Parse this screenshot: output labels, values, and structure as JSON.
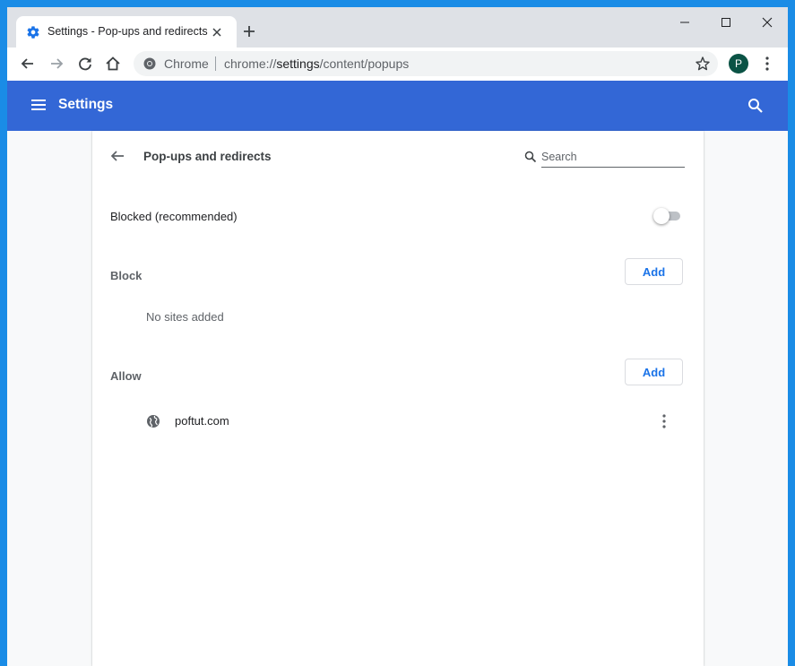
{
  "window": {
    "tab_title": "Settings - Pop-ups and redirects"
  },
  "toolbar": {
    "omnibox_chip": "Chrome",
    "url_scheme": "chrome://",
    "url_host": "settings",
    "url_path": "/content/popups",
    "avatar_letter": "P"
  },
  "header": {
    "title": "Settings"
  },
  "page": {
    "title": "Pop-ups and redirects",
    "search_placeholder": "Search",
    "blocked_label": "Blocked (recommended)",
    "blocked_enabled": false,
    "block_section": {
      "label": "Block",
      "add_label": "Add",
      "empty_text": "No sites added"
    },
    "allow_section": {
      "label": "Allow",
      "add_label": "Add",
      "sites": [
        "poftut.com"
      ]
    }
  },
  "colors": {
    "desktop": "#1a8ce6",
    "header": "#3367d6",
    "accent": "#1a73e8",
    "avatar": "#0b5345"
  }
}
